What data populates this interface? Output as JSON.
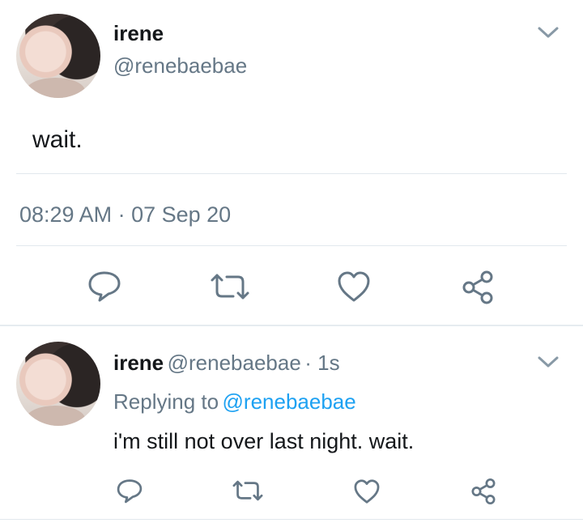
{
  "main_tweet": {
    "author_name": "irene",
    "author_handle": "@renebaebae",
    "text": "wait.",
    "timestamp": "08:29 AM · 07 Sep 20"
  },
  "reply": {
    "author_name": "irene",
    "author_handle": "@renebaebae",
    "time": "· 1s",
    "replying_prefix": "Replying to",
    "replying_to": "@renebaebae",
    "text": "i'm still not over last night. wait."
  },
  "icons": {
    "reply": "comment-icon",
    "retweet": "retweet-icon",
    "like": "heart-icon",
    "share": "share-icon",
    "menu": "chevron-down-icon"
  },
  "colors": {
    "icon_gray": "#657786",
    "link_blue": "#1da1f2",
    "divider": "#e1e8ed"
  }
}
